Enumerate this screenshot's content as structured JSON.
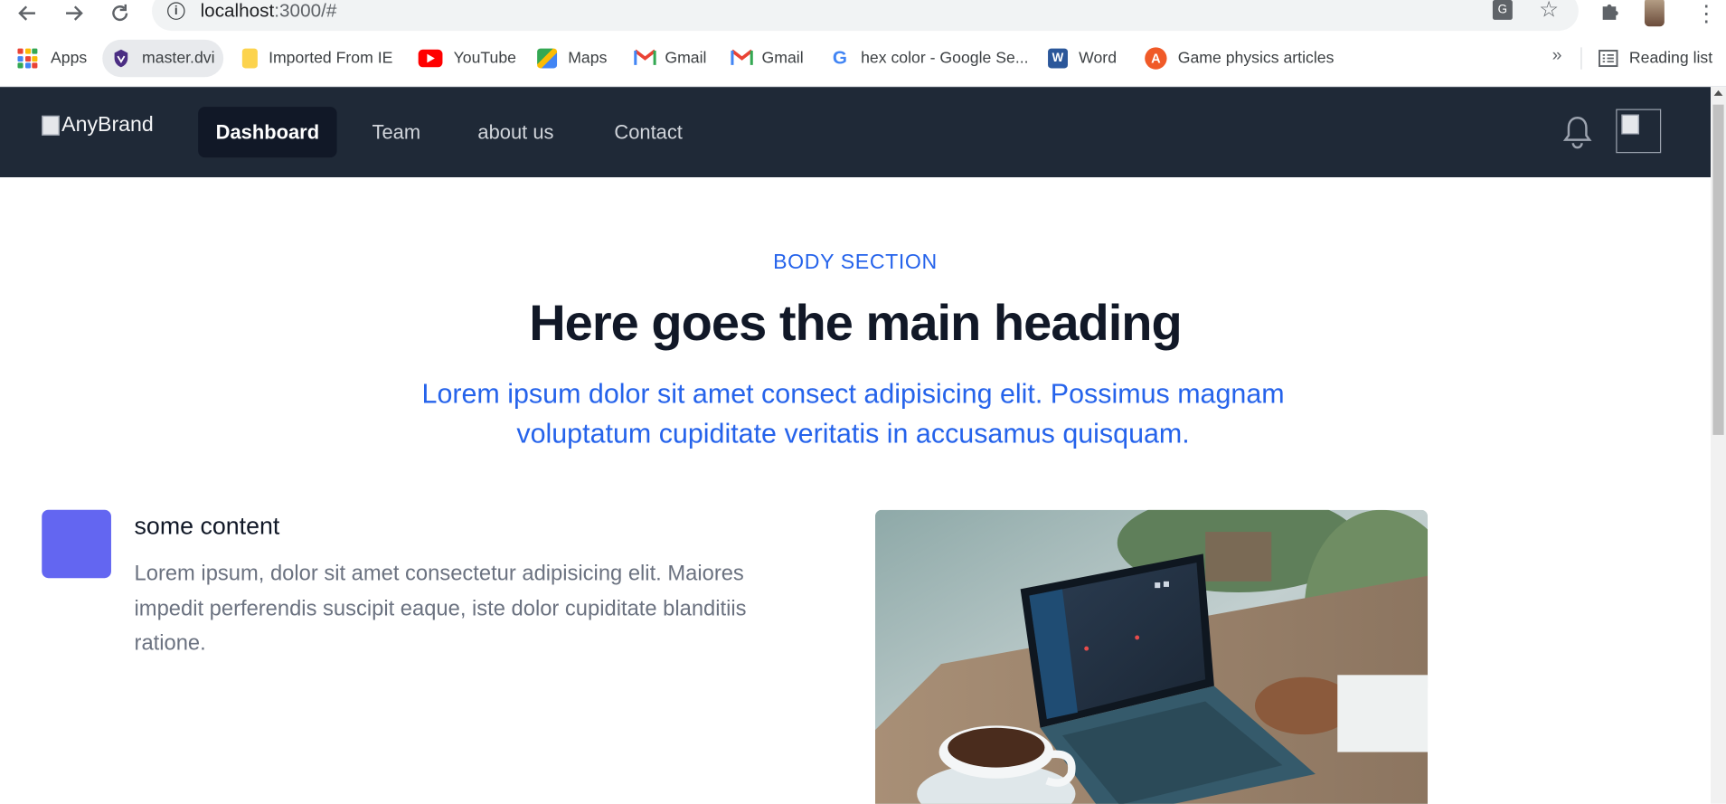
{
  "browser": {
    "url_host": "localhost",
    "url_rest": ":3000/#",
    "bookmarks": [
      {
        "label": "Apps",
        "icon": "apps-grid-icon"
      },
      {
        "label": "master.dvi",
        "icon": "shield-logo-icon"
      },
      {
        "label": "Imported From IE",
        "icon": "folder-icon"
      },
      {
        "label": "YouTube",
        "icon": "youtube-icon"
      },
      {
        "label": "Maps",
        "icon": "maps-icon"
      },
      {
        "label": "Gmail",
        "icon": "gmail-icon"
      },
      {
        "label": "Gmail",
        "icon": "gmail-icon"
      },
      {
        "label": "hex color - Google Se...",
        "icon": "google-icon"
      },
      {
        "label": "Word",
        "icon": "word-icon"
      },
      {
        "label": "Game physics articles",
        "icon": "game-icon"
      }
    ],
    "more_label": "»",
    "reading_list": "Reading list"
  },
  "nav": {
    "brand": "AnyBrand",
    "links": [
      "Dashboard",
      "Team",
      "about us",
      "Contact"
    ],
    "active": "Dashboard"
  },
  "hero": {
    "kicker": "BODY SECTION",
    "heading": "Here goes the main heading",
    "lead": "Lorem ipsum dolor sit amet consect adipisicing elit. Possimus magnam voluptatum cupiditate veritatis in accusamus quisquam."
  },
  "feature": {
    "title": "some content",
    "text": "Lorem ipsum, dolor sit amet consectetur adipisicing elit. Maiores impedit perferendis suscipit eaque, iste dolor cupiditate blanditiis ratione."
  },
  "colors": {
    "nav_bg": "#1f2937",
    "nav_active_bg": "#111827",
    "accent": "#2563eb",
    "feature_square": "#6366f1"
  }
}
